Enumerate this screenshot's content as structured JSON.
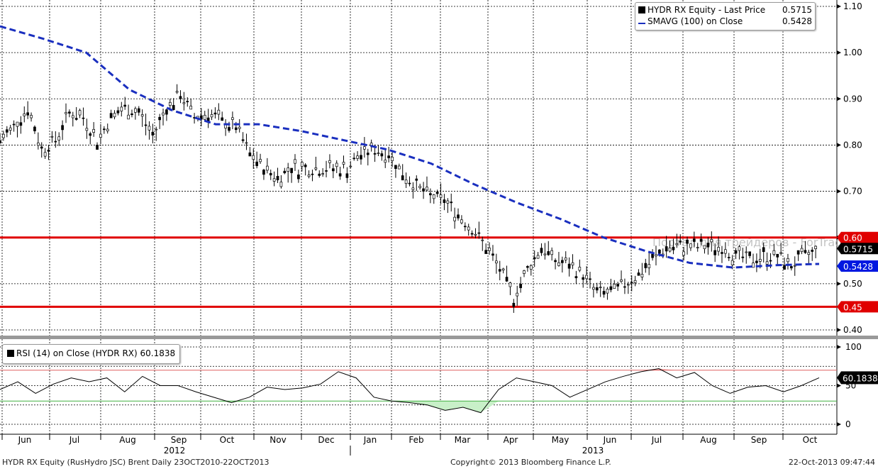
{
  "legend": {
    "series1": "HYDR RX Equity - Last Price",
    "series1_value": "0.5715",
    "series2": "SMAVG (100) on Close",
    "series2_value": "0.5428"
  },
  "rsi_legend": "RSI (14) on Close (HYDR RX) 60.1838",
  "footer": {
    "left": "HYDR RX Equity (RusHydro JSC) Brent  Daily 23OCT2010-22OCT2013",
    "center": "Copyright© 2013 Bloomberg Finance L.P.",
    "right": "22-Oct-2013 09:47:44"
  },
  "watermark": "Портал для трейдеров - ForTrader.ru",
  "colors": {
    "price": "#000000",
    "sma": "#1a2fbf",
    "level": "#e00000",
    "rsi_over": "#e06060",
    "rsi_under": "#40b040",
    "rsi_fill": "#c8f0c8"
  },
  "chart_data": [
    {
      "type": "line",
      "title": "HYDR RX Equity - Last Price",
      "ylim": [
        0.4,
        1.1
      ],
      "yticks": [
        "1.10",
        "1.00",
        "0.90",
        "0.80",
        "0.70",
        "0.60",
        "0.50",
        "0.40"
      ],
      "xticks": [
        "Jun",
        "Jul",
        "Aug",
        "Sep",
        "Oct",
        "Nov",
        "Dec",
        "Jan",
        "Feb",
        "Mar",
        "Apr",
        "May",
        "Jun",
        "Jul",
        "Aug",
        "Sep",
        "Oct"
      ],
      "year_labels": [
        "2012",
        "2013"
      ],
      "price_weekly": [
        0.81,
        0.84,
        0.88,
        0.79,
        0.81,
        0.87,
        0.86,
        0.81,
        0.86,
        0.88,
        0.87,
        0.82,
        0.88,
        0.91,
        0.86,
        0.87,
        0.85,
        0.84,
        0.78,
        0.75,
        0.73,
        0.75,
        0.75,
        0.75,
        0.75,
        0.75,
        0.78,
        0.79,
        0.78,
        0.74,
        0.71,
        0.69,
        0.68,
        0.65,
        0.62,
        0.58,
        0.53,
        0.47,
        0.53,
        0.58,
        0.55,
        0.54,
        0.52,
        0.48,
        0.48,
        0.5,
        0.52,
        0.55,
        0.58,
        0.58,
        0.58,
        0.58,
        0.58,
        0.56,
        0.55,
        0.56,
        0.56,
        0.54,
        0.56,
        0.5715
      ],
      "sma_100": [
        1.057,
        1.03,
        1.0,
        0.92,
        0.875,
        0.845,
        0.845,
        0.83,
        0.81,
        0.79,
        0.76,
        0.715,
        0.675,
        0.64,
        0.6,
        0.57,
        0.545,
        0.535,
        0.54,
        0.5428
      ],
      "last_price": "0.5715",
      "sma_last": "0.5428",
      "levels": [
        {
          "label": "0.60",
          "value": 0.6
        },
        {
          "label": "0.45",
          "value": 0.45
        }
      ]
    },
    {
      "type": "line",
      "title": "RSI (14) on Close (HYDR RX)",
      "ylim": [
        0,
        100
      ],
      "yticks": [
        "100",
        "50",
        "0"
      ],
      "overbought": 70,
      "oversold": 30,
      "values": [
        45,
        55,
        40,
        52,
        60,
        55,
        60,
        42,
        62,
        50,
        50,
        42,
        35,
        28,
        35,
        48,
        45,
        47,
        52,
        68,
        60,
        35,
        30,
        28,
        25,
        18,
        22,
        15,
        45,
        60,
        55,
        50,
        35,
        45,
        55,
        62,
        68,
        72,
        60,
        67,
        50,
        40,
        48,
        50,
        42,
        50,
        60.18
      ],
      "last": "60.1838"
    }
  ]
}
